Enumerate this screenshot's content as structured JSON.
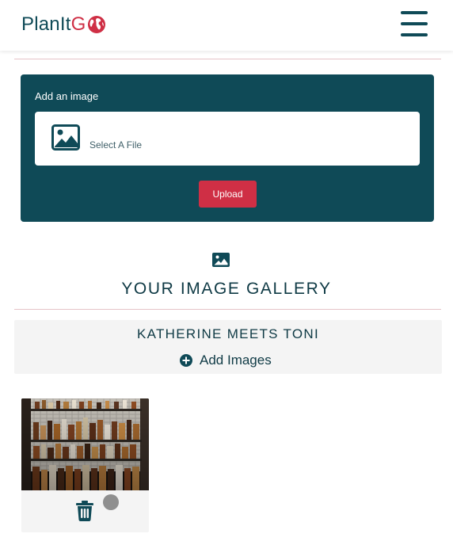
{
  "header": {
    "logo_part1": "PlanIt ",
    "logo_part2": "G",
    "logo_globe_icon": "globe-icon",
    "menu_icon": "hamburger-menu-icon"
  },
  "upload": {
    "label": "Add an image",
    "file_placeholder": "Select A File",
    "file_icon": "image-icon",
    "button_label": "Upload"
  },
  "gallery": {
    "icon": "image-icon",
    "title": "YOUR IMAGE GALLERY"
  },
  "album": {
    "title": "KATHERINE MEETS TONI",
    "add_icon": "plus-circle-icon",
    "add_label": "Add Images"
  },
  "images": [
    {
      "photo": "bar-shelves-photo",
      "delete_icon": "trash-icon",
      "select_icon": "radio-dot-icon"
    }
  ],
  "colors": {
    "brand_teal": "#0f4a57",
    "brand_red": "#cf2f45",
    "panel_gray": "#f4f4f4",
    "divider": "#e6c3c7"
  }
}
